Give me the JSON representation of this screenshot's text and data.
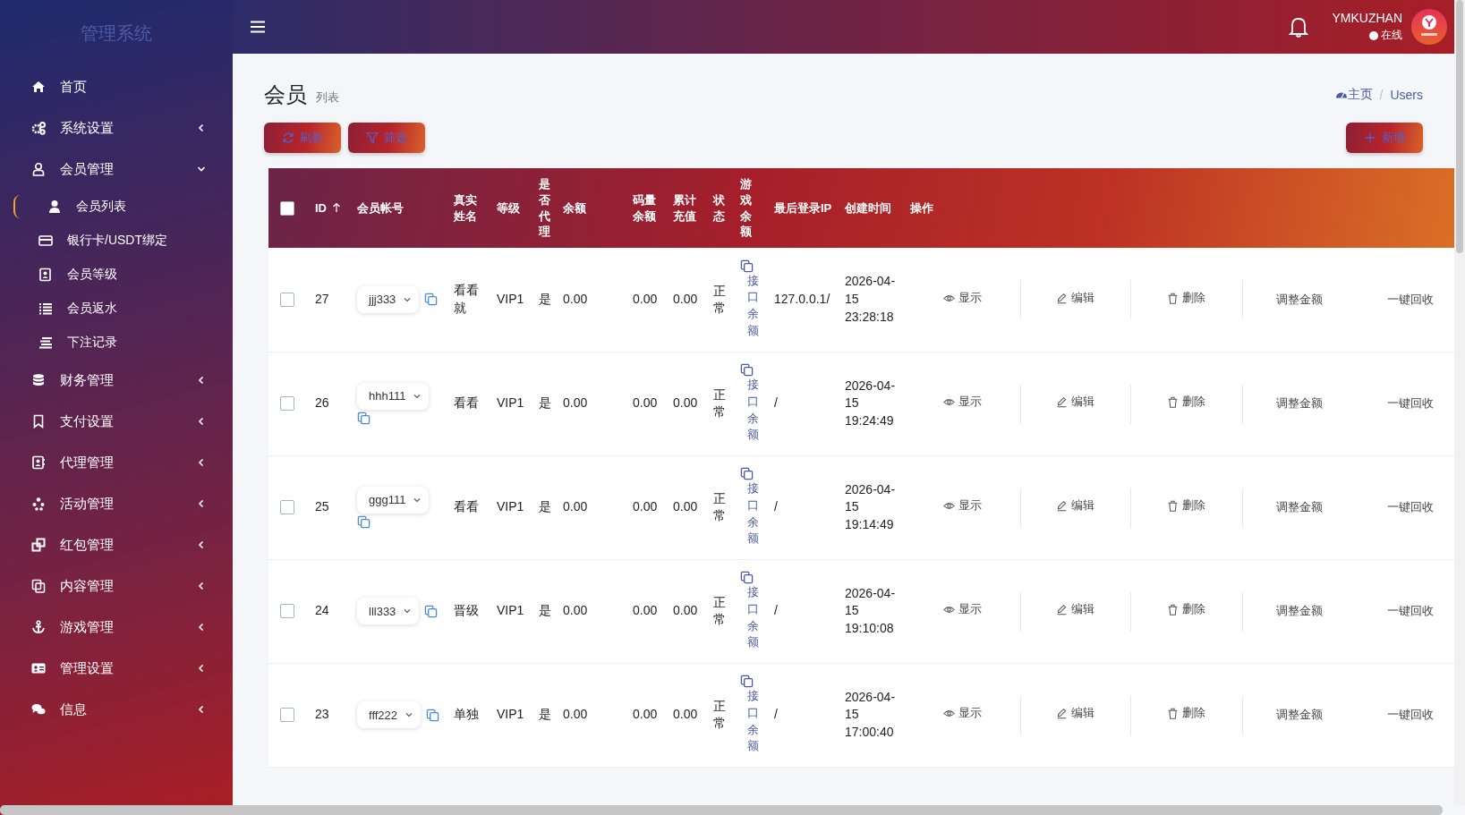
{
  "sidebar": {
    "title": "管理系统",
    "items": [
      {
        "label": "首页",
        "kind": "link"
      },
      {
        "label": "系统设置",
        "kind": "menu",
        "expanded": false
      },
      {
        "label": "会员管理",
        "kind": "menu",
        "expanded": true,
        "children": [
          {
            "label": "会员列表",
            "selected": true
          },
          {
            "label": "银行卡/USDT绑定",
            "selected": false
          },
          {
            "label": "会员等级",
            "selected": false
          },
          {
            "label": "会员返水",
            "selected": false
          },
          {
            "label": "下注记录",
            "selected": false
          }
        ]
      },
      {
        "label": "财务管理",
        "kind": "menu",
        "expanded": false
      },
      {
        "label": "支付设置",
        "kind": "menu",
        "expanded": false
      },
      {
        "label": "代理管理",
        "kind": "menu",
        "expanded": false
      },
      {
        "label": "活动管理",
        "kind": "menu",
        "expanded": false
      },
      {
        "label": "红包管理",
        "kind": "menu",
        "expanded": false
      },
      {
        "label": "内容管理",
        "kind": "menu",
        "expanded": false
      },
      {
        "label": "游戏管理",
        "kind": "menu",
        "expanded": false
      },
      {
        "label": "管理设置",
        "kind": "menu",
        "expanded": false
      },
      {
        "label": "信息",
        "kind": "menu",
        "expanded": false
      }
    ]
  },
  "header": {
    "user": "YMKUZHAN",
    "status": "在线"
  },
  "page": {
    "title": "会员",
    "subtitle": "列表",
    "breadcrumb": {
      "separator": "/",
      "items": [
        "主页",
        "Users"
      ]
    }
  },
  "toolbar": {
    "left_buttons": [
      {
        "label": "刷新",
        "kind": "refresh"
      },
      {
        "label": "筛选",
        "kind": "filter"
      }
    ],
    "right_buttons": [
      {
        "label": "新增",
        "kind": "add"
      }
    ]
  },
  "table": {
    "select_all": {
      "checked": false
    },
    "columns": [
      {
        "label": "ID",
        "sorted": true
      },
      {
        "label": "会员帐号"
      },
      {
        "label": "真实姓名"
      },
      {
        "label": "等级"
      },
      {
        "label": "是否代理"
      },
      {
        "label": "余额"
      },
      {
        "label": "码量余额"
      },
      {
        "label": "累计充值"
      },
      {
        "label": "状态"
      },
      {
        "label": "游戏余额"
      },
      {
        "label": "最后登录IP"
      },
      {
        "label": "创建时间"
      },
      {
        "label": "操作"
      }
    ],
    "rows": [
      {
        "checked": false,
        "id": "27",
        "account": "jjj333",
        "real_name": "看看就",
        "level": "VIP1",
        "agent": "是",
        "balance": "0.00",
        "code_balance": "0.00",
        "total_recharge": "0.00",
        "status": "正常",
        "game_balance": "接口余额",
        "last_ip": "127.0.0.1/",
        "created": "2026-04-15 23:28:18",
        "actions": [
          {
            "label": "显示",
            "kind": "view"
          },
          {
            "label": "编辑",
            "kind": "edit"
          },
          {
            "label": "删除",
            "kind": "delete"
          },
          {
            "label": "调整金额",
            "kind": "plain"
          },
          {
            "label": "一键回收",
            "kind": "plain"
          }
        ]
      },
      {
        "checked": false,
        "id": "26",
        "account": "hhh111",
        "real_name": "看看",
        "level": "VIP1",
        "agent": "是",
        "balance": "0.00",
        "code_balance": "0.00",
        "total_recharge": "0.00",
        "status": "正常",
        "game_balance": "接口余额",
        "last_ip": "/",
        "created": "2026-04-15 19:24:49",
        "actions": [
          {
            "label": "显示",
            "kind": "view"
          },
          {
            "label": "编辑",
            "kind": "edit"
          },
          {
            "label": "删除",
            "kind": "delete"
          },
          {
            "label": "调整金额",
            "kind": "plain"
          },
          {
            "label": "一键回收",
            "kind": "plain"
          }
        ]
      },
      {
        "checked": false,
        "id": "25",
        "account": "ggg111",
        "real_name": "看看",
        "level": "VIP1",
        "agent": "是",
        "balance": "0.00",
        "code_balance": "0.00",
        "total_recharge": "0.00",
        "status": "正常",
        "game_balance": "接口余额",
        "last_ip": "/",
        "created": "2026-04-15 19:14:49",
        "actions": [
          {
            "label": "显示",
            "kind": "view"
          },
          {
            "label": "编辑",
            "kind": "edit"
          },
          {
            "label": "删除",
            "kind": "delete"
          },
          {
            "label": "调整金额",
            "kind": "plain"
          },
          {
            "label": "一键回收",
            "kind": "plain"
          }
        ]
      },
      {
        "checked": false,
        "id": "24",
        "account": "lll333",
        "real_name": "晋级",
        "level": "VIP1",
        "agent": "是",
        "balance": "0.00",
        "code_balance": "0.00",
        "total_recharge": "0.00",
        "status": "正常",
        "game_balance": "接口余额",
        "last_ip": "/",
        "created": "2026-04-15 19:10:08",
        "actions": [
          {
            "label": "显示",
            "kind": "view"
          },
          {
            "label": "编辑",
            "kind": "edit"
          },
          {
            "label": "删除",
            "kind": "delete"
          },
          {
            "label": "调整金额",
            "kind": "plain"
          },
          {
            "label": "一键回收",
            "kind": "plain"
          }
        ]
      },
      {
        "checked": false,
        "id": "23",
        "account": "fff222",
        "real_name": "单独",
        "level": "VIP1",
        "agent": "是",
        "balance": "0.00",
        "code_balance": "0.00",
        "total_recharge": "0.00",
        "status": "正常",
        "game_balance": "接口余额",
        "last_ip": "/",
        "created": "2026-04-15 17:00:40",
        "actions": [
          {
            "label": "显示",
            "kind": "view"
          },
          {
            "label": "编辑",
            "kind": "edit"
          },
          {
            "label": "删除",
            "kind": "delete"
          },
          {
            "label": "调整金额",
            "kind": "plain"
          },
          {
            "label": "一键回收",
            "kind": "plain"
          }
        ]
      }
    ]
  }
}
